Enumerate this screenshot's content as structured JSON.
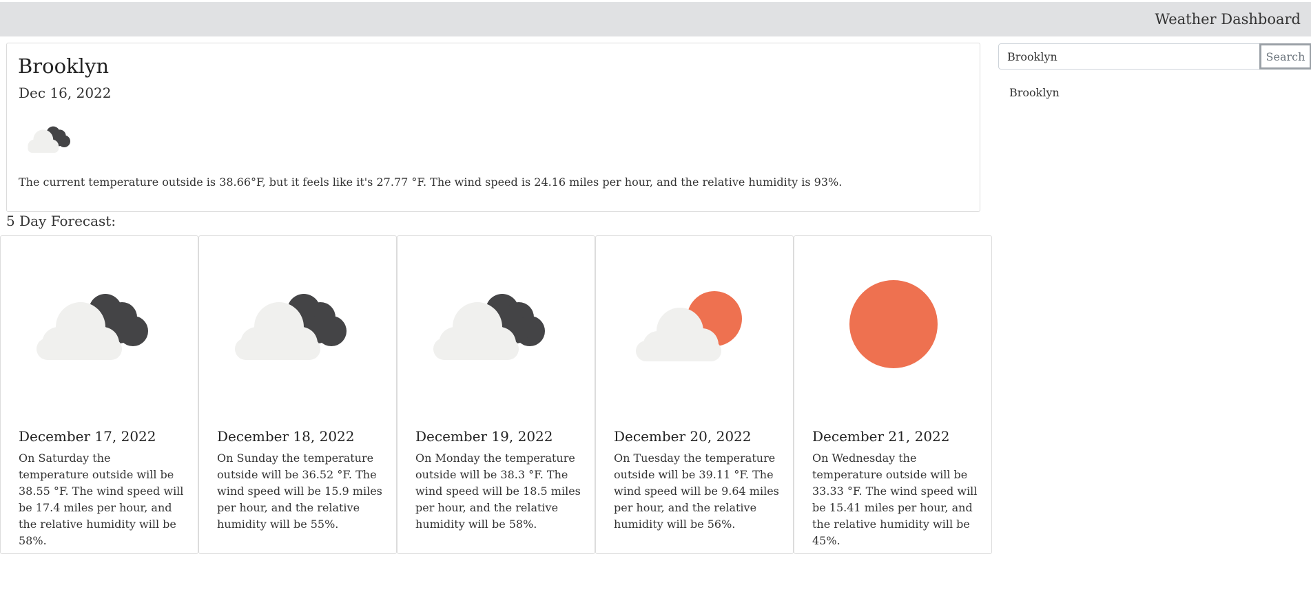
{
  "header": {
    "title": "Weather Dashboard"
  },
  "current": {
    "city": "Brooklyn",
    "date": "Dec 16, 2022",
    "icon": "night-cloudy-icon",
    "description": "The current temperature outside is 38.66°F, but it feels like it's 27.77 °F. The wind speed is 24.16 miles per hour, and the relative humidity is 93%."
  },
  "search": {
    "value": "Brooklyn",
    "placeholder": "",
    "button_label": "Search"
  },
  "history": [
    {
      "label": "Brooklyn"
    }
  ],
  "forecast": {
    "title": "5 Day Forecast:",
    "days": [
      {
        "date": "December 17, 2022",
        "icon": "night-cloudy-icon",
        "text": "On Saturday the temperature outside will be 38.55 °F. The wind speed will be 17.4 miles per hour, and the relative humidity will be 58%."
      },
      {
        "date": "December 18, 2022",
        "icon": "night-cloudy-icon",
        "text": "On Sunday the temperature outside will be 36.52 °F. The wind speed will be 15.9 miles per hour, and the relative humidity will be 55%."
      },
      {
        "date": "December 19, 2022",
        "icon": "night-cloudy-icon",
        "text": "On Monday the temperature outside will be 38.3 °F. The wind speed will be 18.5 miles per hour, and the relative humidity will be 58%."
      },
      {
        "date": "December 20, 2022",
        "icon": "partly-sunny-icon",
        "text": "On Tuesday the temperature outside will be 39.11 °F. The wind speed will be 9.64 miles per hour, and the relative humidity will be 56%."
      },
      {
        "date": "December 21, 2022",
        "icon": "sun-icon",
        "text": "On Wednesday the temperature outside will be 33.33 °F. The wind speed will be 15.41 miles per hour, and the relative humidity will be 45%."
      }
    ]
  },
  "colors": {
    "header_bg": "#e0e1e3",
    "dark_cloud": "#444446",
    "light_cloud": "#f0f0ee",
    "sun": "#ee7150"
  }
}
